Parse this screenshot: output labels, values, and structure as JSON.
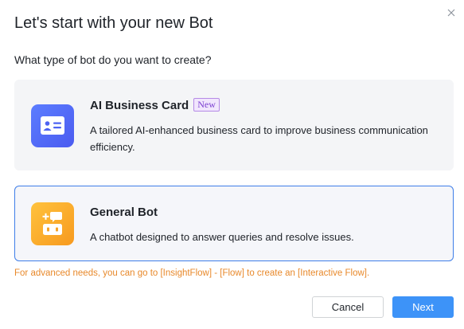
{
  "dialog": {
    "title": "Let's start with your new Bot",
    "question": "What type of bot do you want to create?",
    "close_icon": "close-icon"
  },
  "cards": [
    {
      "id": "ai-business-card",
      "title": "AI Business Card",
      "badge": "New",
      "description": "A tailored AI-enhanced business card to improve business communication efficiency.",
      "icon": "id-card-icon",
      "selected": false
    },
    {
      "id": "general-bot",
      "title": "General Bot",
      "description": "A chatbot designed to answer queries and resolve issues.",
      "icon": "bot-chat-icon",
      "selected": true
    }
  ],
  "hint": "For advanced needs, you can go to [InsightFlow] - [Flow] to create an [Interactive Flow].",
  "buttons": {
    "cancel": "Cancel",
    "next": "Next"
  },
  "colors": {
    "primary": "#3d93f8",
    "selected_border": "#3f7ee8",
    "hint": "#e8892b",
    "badge": "#7b3fd1"
  }
}
